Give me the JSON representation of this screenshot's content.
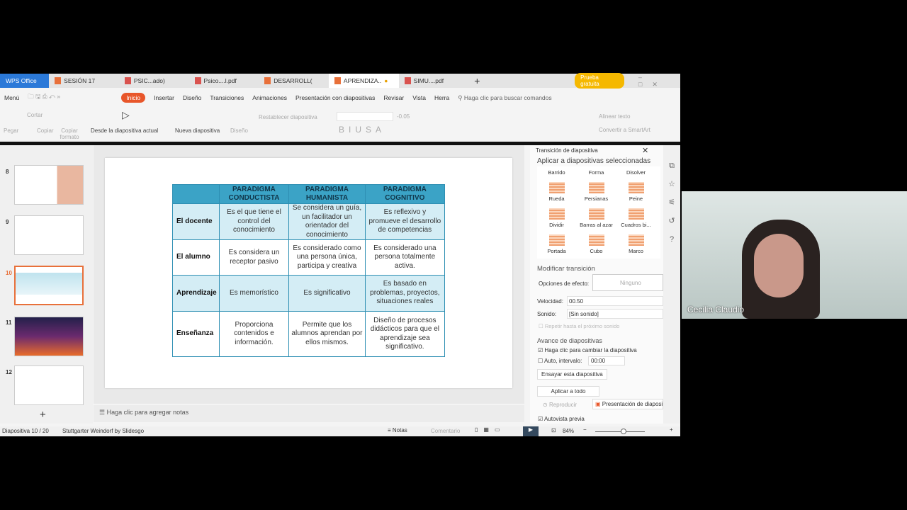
{
  "tabs": {
    "brand": "WPS Office",
    "items": [
      "SESIÓN 17",
      "PSIC...ado)",
      "Psico....l.pdf",
      "DESARROLL(",
      "APRENDIZA..",
      "SIMU....pdf"
    ],
    "trial": "Prueba gratuita"
  },
  "menu": {
    "menu": "Menú",
    "items": [
      "Inicio",
      "Insertar",
      "Diseño",
      "Transiciones",
      "Animaciones",
      "Presentación con diapositivas",
      "Revisar",
      "Vista",
      "Herra"
    ],
    "search": "Haga clic para buscar comandos"
  },
  "ribbon": {
    "pegar": "Pegar",
    "cortar": "Cortar",
    "copiar": "Copiar",
    "copiar_formato": "Copiar formato",
    "desde": "Desde la diapositiva actual",
    "nueva": "Nueva diapositiva",
    "diseno": "Diseño",
    "restablecer": "Restablecer diapositiva",
    "size": "-0.05",
    "alinear": "Alinear texto",
    "smartart": "Convertir a SmartArt"
  },
  "slides": [
    "8",
    "9",
    "10",
    "11",
    "12"
  ],
  "slide_table": {
    "headers": [
      "",
      "PARADIGMA CONDUCTISTA",
      "PARADIGMA HUMANISTA",
      "PARADIGMA COGNITIVO"
    ],
    "rows": [
      [
        "El docente",
        "Es el que tiene el control del conocimiento",
        "Se considera un guía, un facilitador un orientador del conocimiento",
        "Es reflexivo y promueve el desarrollo de competencias"
      ],
      [
        "El alumno",
        "Es considera un receptor pasivo",
        "Es considerado como una persona única, participa y creativa",
        "Es considerado una persona totalmente activa."
      ],
      [
        "Aprendizaje",
        "Es memorístico",
        "Es significativo",
        "Es basado en problemas, proyectos, situaciones reales"
      ],
      [
        "Enseñanza",
        "Proporciona contenidos e información.",
        "Permite que los alumnos aprendan por ellos mismos.",
        "Diseño de procesos didácticos para que el aprendizaje sea  significativo."
      ]
    ]
  },
  "notes": "Haga clic para agregar notas",
  "panel": {
    "title": "Transición de diapositiva",
    "apply_selected": "Aplicar a diapositivas seleccionadas",
    "effects": [
      "Barrido",
      "Forma",
      "Disolver",
      "Rueda",
      "Persianas",
      "Peine",
      "Dividir",
      "Barras al azar",
      "Cuadros bi...",
      "Portada",
      "Cubo",
      "Marco"
    ],
    "modify": "Modificar transición",
    "options_label": "Opciones de efecto:",
    "options_value": "Ninguno",
    "speed_label": "Velocidad:",
    "speed": "00.50",
    "sound_label": "Sonido:",
    "sound": "[Sin sonido]",
    "repeat": "Repetir hasta el próximo sonido",
    "advance": "Avance de diapositivas",
    "click": "Haga clic para cambiar la diapositiva",
    "auto": "Auto, intervalo:",
    "interval": "00:00",
    "rehearse": "Ensayar esta diapositiva",
    "apply_all": "Aplicar a todo",
    "play": "Reproducir",
    "slideshow": "Presentación de diaposi",
    "autopreview": "Autovista previa"
  },
  "status": {
    "slide": "Diapositiva  10 / 20",
    "theme": "Stuttgarter Weindorf by Slidesgo",
    "notes": "Notas",
    "comment": "Comentario",
    "zoom": "84%"
  },
  "webcam": {
    "name": "Cecilia Claudio"
  }
}
